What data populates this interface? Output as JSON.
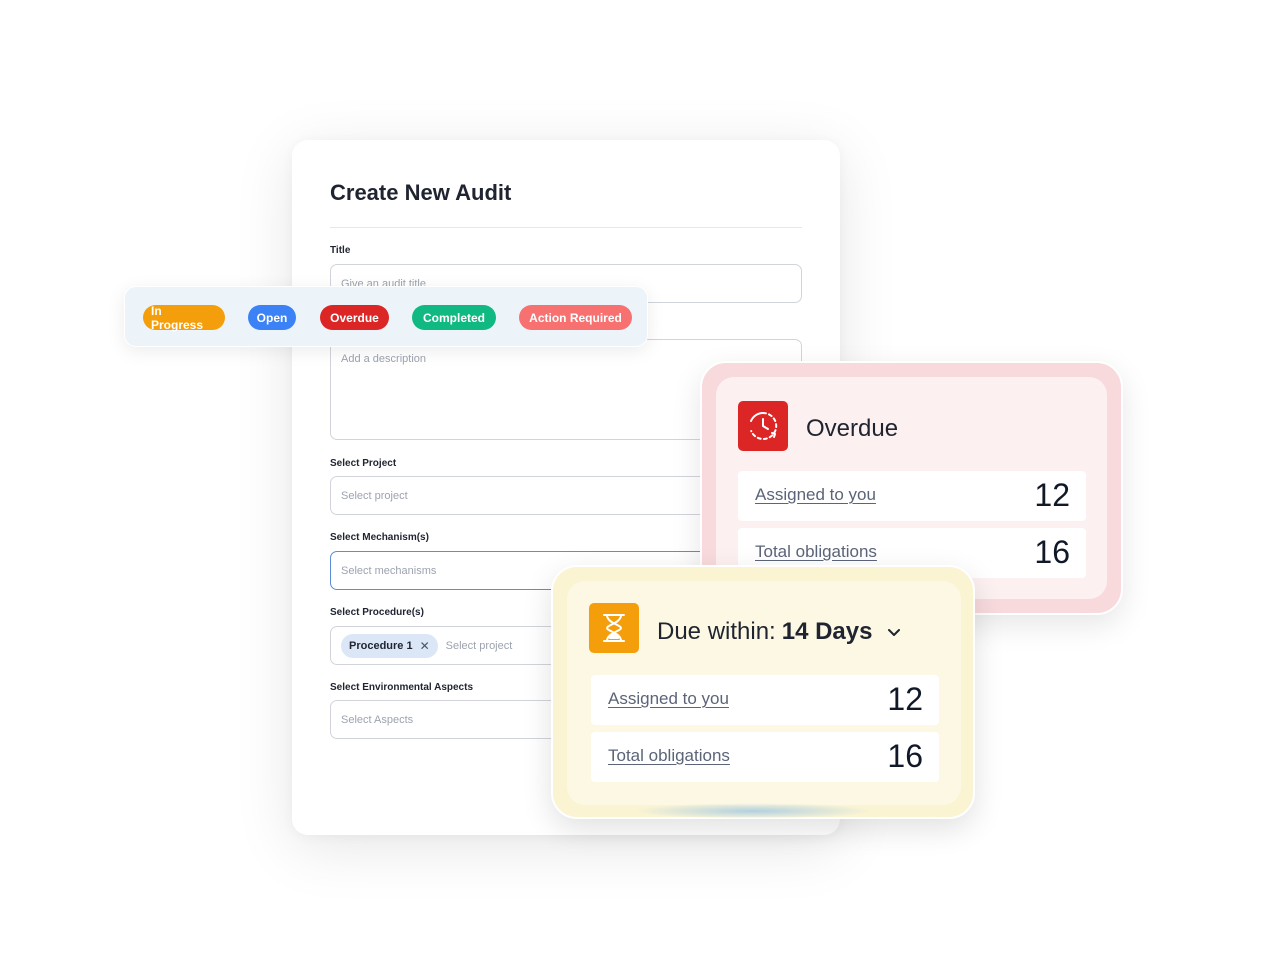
{
  "form": {
    "title": "Create New Audit",
    "fields": {
      "title_label": "Title",
      "title_placeholder": "Give an audit title",
      "description_placeholder": "Add a description",
      "project_label": "Select Project",
      "project_placeholder": "Select project",
      "mechanism_label": "Select Mechanism(s)",
      "mechanism_placeholder": "Select mechanisms",
      "procedure_label": "Select Procedure(s)",
      "procedure_chip": "Procedure 1",
      "procedure_chip_remove": "✕",
      "procedure_placeholder": "Select project",
      "aspects_label": "Select Environmental Aspects",
      "aspects_placeholder": "Select Aspects"
    }
  },
  "statuses": [
    {
      "label": "In Progress",
      "color": "#f59e0b"
    },
    {
      "label": "Open",
      "color": "#3b82f6"
    },
    {
      "label": "Overdue",
      "color": "#dc2626"
    },
    {
      "label": "Completed",
      "color": "#10b981"
    },
    {
      "label": "Action Required",
      "color": "#f87171"
    }
  ],
  "overdue_widget": {
    "icon": "clock-rotate-icon",
    "heading": "Overdue",
    "rows": [
      {
        "label": "Assigned to you",
        "value": "12"
      },
      {
        "label": "Total obligations",
        "value": "16"
      }
    ]
  },
  "due_widget": {
    "icon": "hourglass-icon",
    "heading_prefix": "Due within:",
    "heading_value": "14 Days",
    "rows": [
      {
        "label": "Assigned to you",
        "value": "12"
      },
      {
        "label": "Total obligations",
        "value": "16"
      }
    ]
  }
}
